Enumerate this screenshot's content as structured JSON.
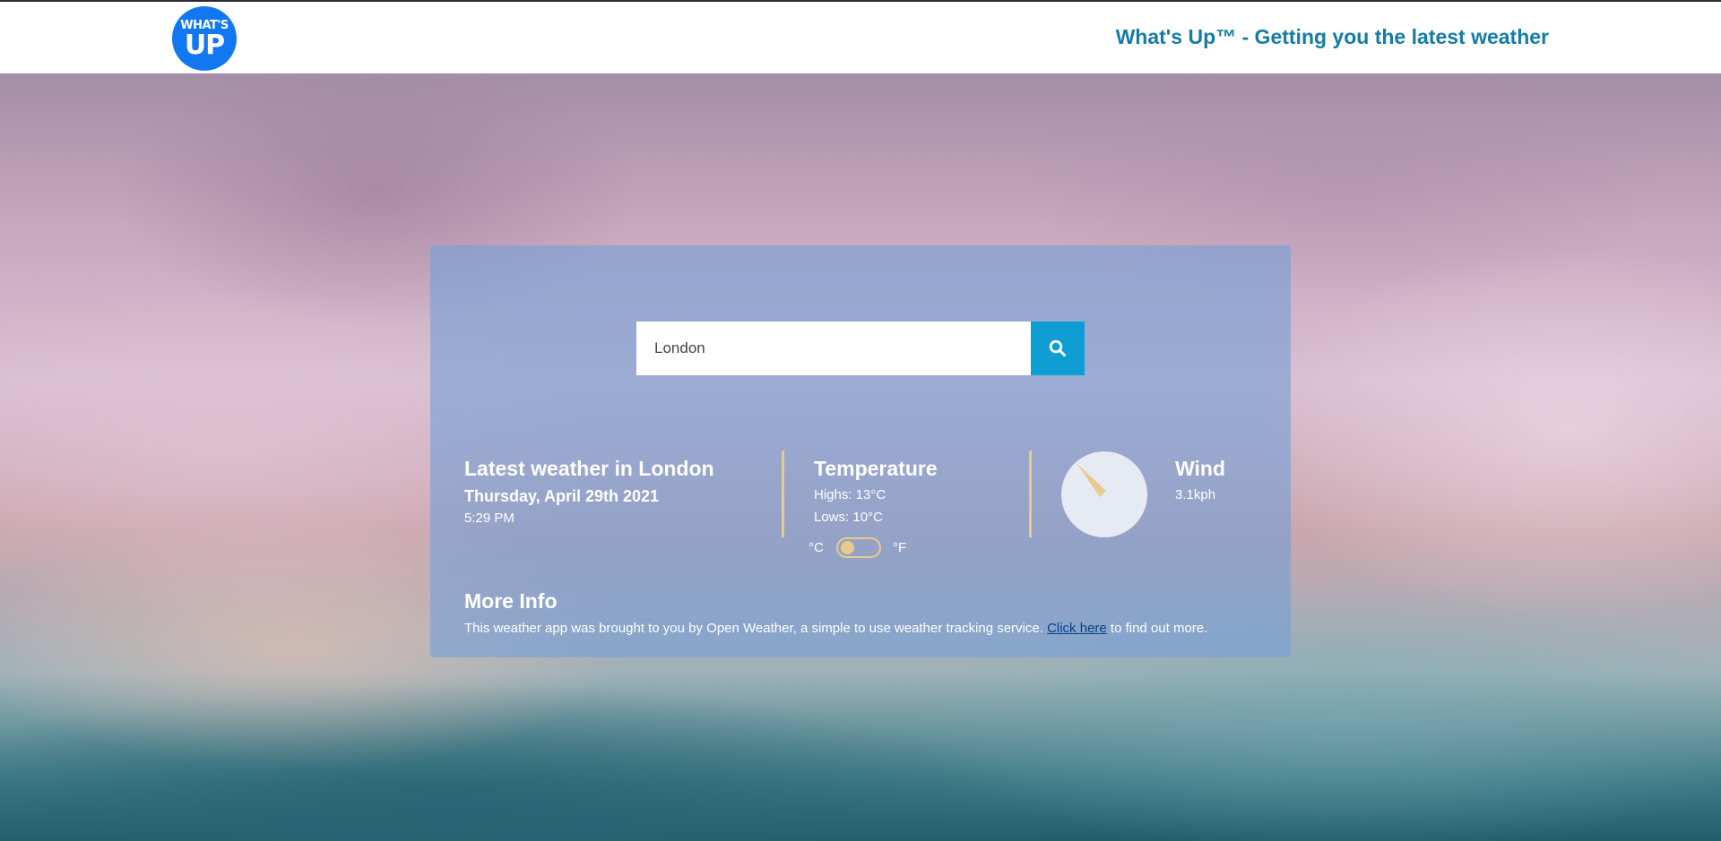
{
  "header": {
    "logo": {
      "top_text": "WHAT'S",
      "bottom_text": "UP",
      "color": "#1278f2"
    },
    "tagline": "What's Up™ - Getting you the latest weather",
    "tagline_color": "#147ca6"
  },
  "search": {
    "value": "London",
    "placeholder": "London",
    "button_icon": "search-icon",
    "button_color": "#0f9ed3"
  },
  "latest": {
    "title": "Latest weather in London",
    "date": "Thursday, April 29th 2021",
    "time": "5:29 PM"
  },
  "temperature": {
    "title": "Temperature",
    "highs": "Highs: 13°C",
    "lows": "Lows: 10°C",
    "unit_c": "°C",
    "unit_f": "°F",
    "selected_unit": "°C"
  },
  "wind": {
    "title": "Wind",
    "speed": "3.1kph",
    "direction_icon": "compass-icon"
  },
  "more_info": {
    "title": "More Info",
    "text_before": "This weather app was brought to you by Open Weather, a simple to use weather tracking service. ",
    "link_text": "Click here",
    "text_after": " to find out more."
  },
  "colors": {
    "accent": "#ebc98a",
    "panel": "#76a0d6"
  }
}
